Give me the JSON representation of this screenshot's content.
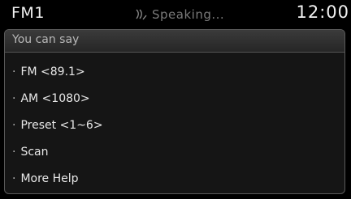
{
  "status_bar": {
    "band": "FM1",
    "speaking_text": "Speaking...",
    "speaking_icon": "voice-wave-icon",
    "clock": "12:00"
  },
  "panel": {
    "title": "You can say",
    "commands": [
      {
        "bullet": "·",
        "label": "FM <89.1>"
      },
      {
        "bullet": "·",
        "label": "AM <1080>"
      },
      {
        "bullet": "·",
        "label": "Preset <1~6>"
      },
      {
        "bullet": "·",
        "label": "Scan"
      },
      {
        "bullet": "·",
        "label": "More Help"
      }
    ]
  },
  "colors": {
    "background": "#000000",
    "text_primary": "#f2f2f2",
    "text_dim": "#7a7a7a",
    "panel_border": "#5a5a5a"
  }
}
